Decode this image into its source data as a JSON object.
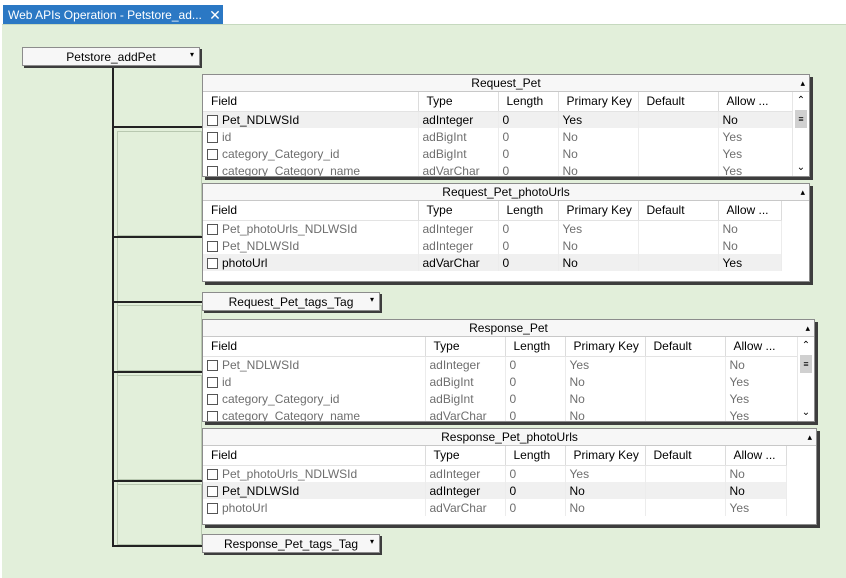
{
  "tab": {
    "title": "Web APIs Operation - Petstore_ad...",
    "close": "✕"
  },
  "root": {
    "label": "Petstore_addPet",
    "arrow": "▾"
  },
  "columns": [
    "Field",
    "Type",
    "Length",
    "Primary Key",
    "Default",
    "Allow ..."
  ],
  "panels": [
    {
      "title": "Request_Pet",
      "rows": [
        [
          "Pet_NDLWSId",
          "adInteger",
          "0",
          "Yes",
          "",
          "No"
        ],
        [
          "id",
          "adBigInt",
          "0",
          "No",
          "",
          "Yes"
        ],
        [
          "category_Category_id",
          "adBigInt",
          "0",
          "No",
          "",
          "Yes"
        ],
        [
          "category_Category_name",
          "adVarChar",
          "0",
          "No",
          "",
          "Yes"
        ]
      ]
    },
    {
      "title": "Request_Pet_photoUrls",
      "rows": [
        [
          "Pet_photoUrls_NDLWSId",
          "adInteger",
          "0",
          "Yes",
          "",
          "No"
        ],
        [
          "Pet_NDLWSId",
          "adInteger",
          "0",
          "No",
          "",
          "No"
        ],
        [
          "photoUrl",
          "adVarChar",
          "0",
          "No",
          "",
          "Yes"
        ]
      ]
    },
    {
      "title": "Response_Pet",
      "rows": [
        [
          "Pet_NDLWSId",
          "adInteger",
          "0",
          "Yes",
          "",
          "No"
        ],
        [
          "id",
          "adBigInt",
          "0",
          "No",
          "",
          "Yes"
        ],
        [
          "category_Category_id",
          "adBigInt",
          "0",
          "No",
          "",
          "Yes"
        ],
        [
          "category_Category_name",
          "adVarChar",
          "0",
          "No",
          "",
          "Yes"
        ]
      ]
    },
    {
      "title": "Response_Pet_photoUrls",
      "rows": [
        [
          "Pet_photoUrls_NDLWSId",
          "adInteger",
          "0",
          "Yes",
          "",
          "No"
        ],
        [
          "Pet_NDLWSId",
          "adInteger",
          "0",
          "No",
          "",
          "No"
        ],
        [
          "photoUrl",
          "adVarChar",
          "0",
          "No",
          "",
          "Yes"
        ]
      ]
    }
  ],
  "collapsed": [
    {
      "label": "Request_Pet_tags_Tag",
      "arrow": "▾"
    },
    {
      "label": "Response_Pet_tags_Tag",
      "arrow": "▾"
    }
  ],
  "icons": {
    "collapse": "▴",
    "scroll_up": "⌃",
    "scroll_down": "⌄",
    "scroll_grip": "≡"
  }
}
